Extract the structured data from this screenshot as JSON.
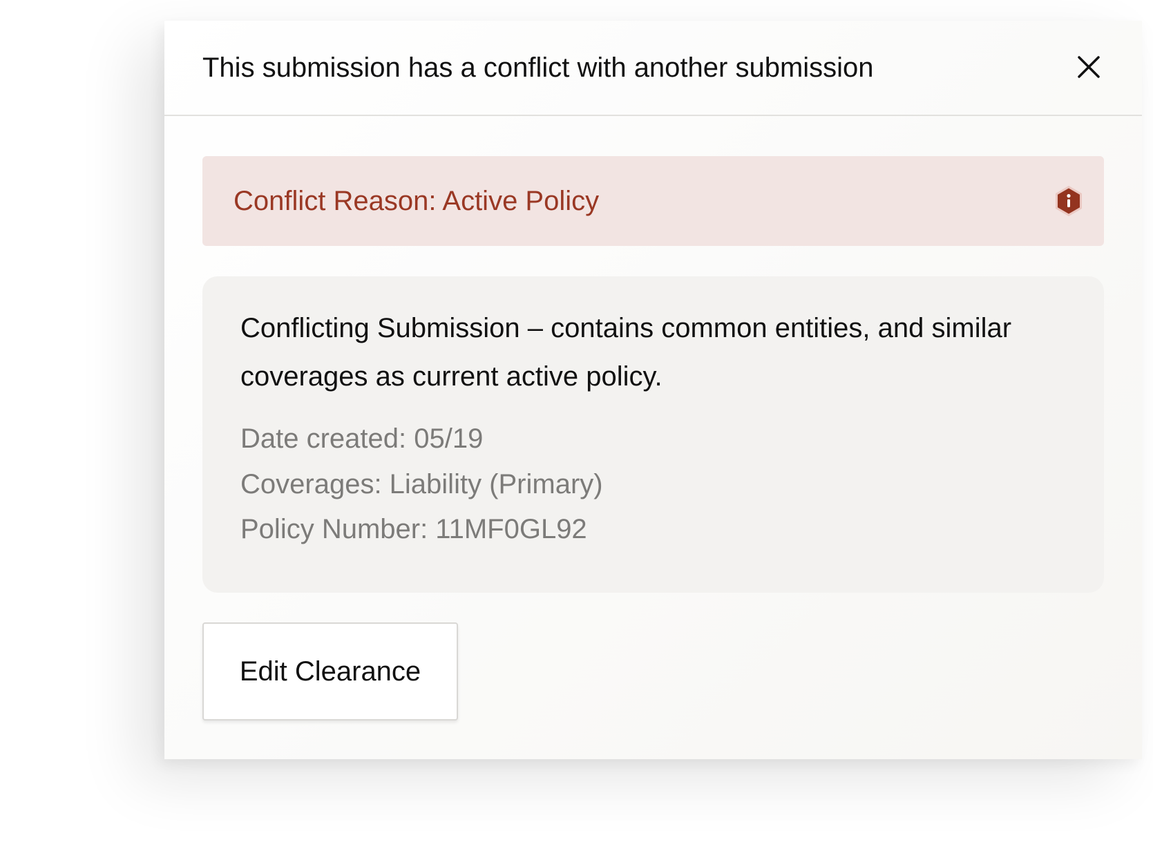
{
  "dialog": {
    "title": "This submission has a conflict with another submission",
    "close_icon": "close-icon"
  },
  "conflict_reason": {
    "text": "Conflict Reason: Active Policy",
    "icon": "info-icon",
    "text_color": "#9a3824",
    "background_color": "#f2e4e2"
  },
  "conflicting_submission": {
    "description": "Conflicting Submission – contains common entities, and similar coverages as current active policy.",
    "date_created": "Date created: 05/19",
    "coverages": "Coverages: Liability (Primary)",
    "policy_number": "Policy Number: 11MF0GL92"
  },
  "actions": {
    "edit_clearance_label": "Edit Clearance"
  }
}
